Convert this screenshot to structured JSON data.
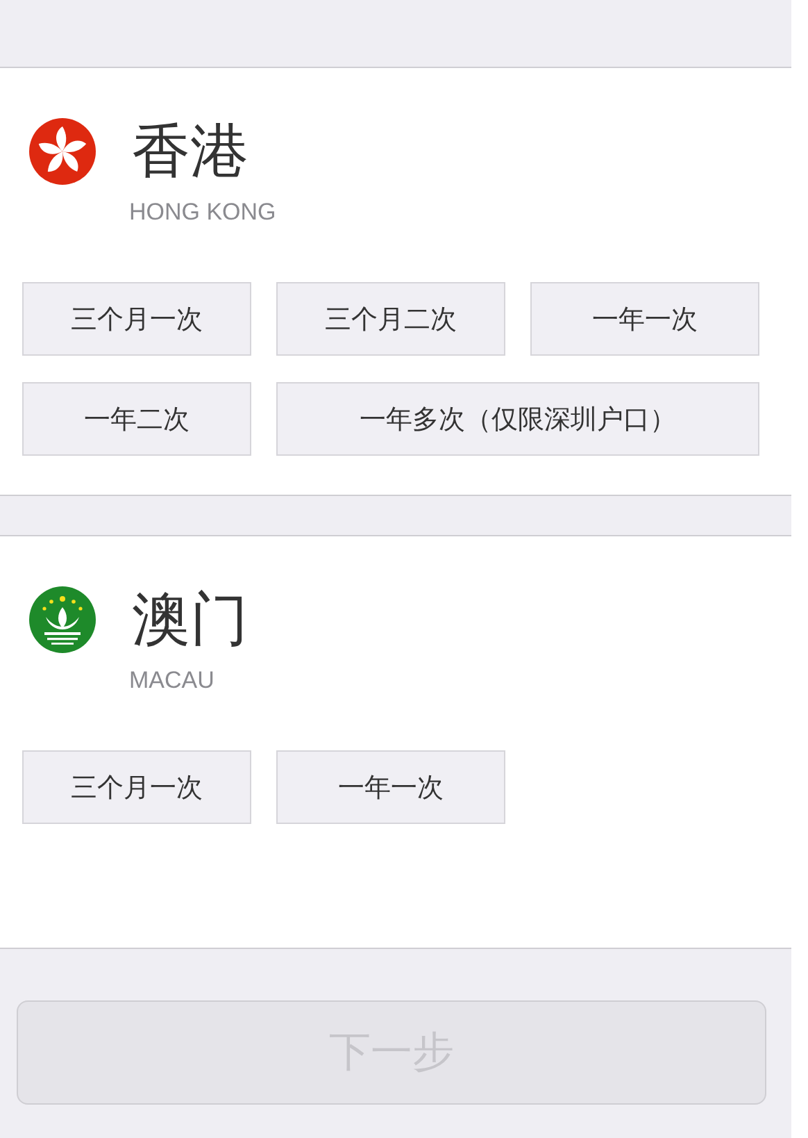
{
  "regions": [
    {
      "kind": "hongkong",
      "name": "香港",
      "name_en": "HONG KONG",
      "options": [
        {
          "label": "三个月一次",
          "kind": "normal"
        },
        {
          "label": "三个月二次",
          "kind": "normal"
        },
        {
          "label": "一年一次",
          "kind": "normal"
        },
        {
          "label": "一年二次",
          "kind": "normal"
        },
        {
          "label": "一年多次（仅限深圳户口）",
          "kind": "wide"
        }
      ]
    },
    {
      "kind": "macau",
      "name": "澳门",
      "name_en": "MACAU",
      "options": [
        {
          "label": "三个月一次",
          "kind": "normal"
        },
        {
          "label": "一年一次",
          "kind": "normal"
        }
      ]
    }
  ],
  "next_button": {
    "label": "下一步",
    "disabled": true
  }
}
